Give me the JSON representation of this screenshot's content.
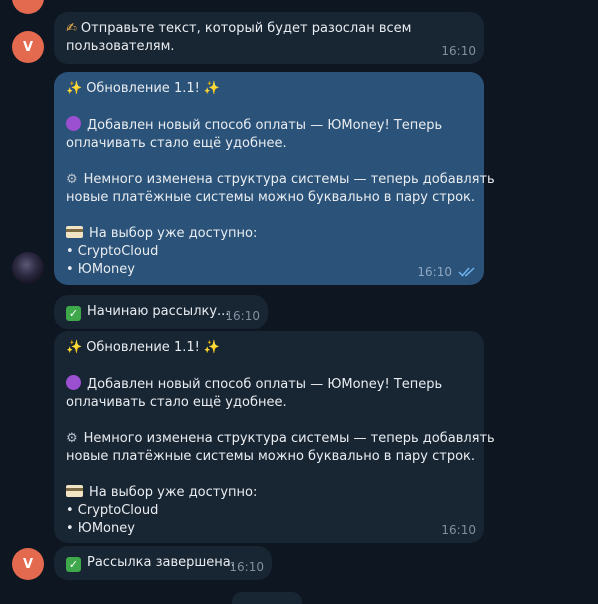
{
  "messages": {
    "prompt": {
      "avatar_letter": "V",
      "line1": "Отправьте текст, который будет разослан всем",
      "line2": "пользователям.",
      "time": "16:10",
      "icon": "writing-hand-emoji"
    },
    "broadcast_out": {
      "title": "Обновление 1.1!",
      "p1_line1": "Добавлен новый способ оплаты — ЮMoney! Теперь",
      "p1_line2": "оплачивать стало ещё удобнее.",
      "p2_line1": "Немного изменена структура системы — теперь добавлять",
      "p2_line2": "новые платёжные системы можно буквально в пару строк.",
      "p3_line1": "На выбор уже доступно:",
      "item1": "• CryptoCloud",
      "item2": "• ЮMoney",
      "time": "16:10",
      "status_icon": "double-check-icon"
    },
    "starting": {
      "text": "Начинаю рассылку...",
      "time": "16:10",
      "icon": "check-mark-emoji"
    },
    "broadcast_in": {
      "title": "Обновление 1.1!",
      "p1_line1": "Добавлен новый способ оплаты — ЮMoney! Теперь",
      "p1_line2": "оплачивать стало ещё удобнее.",
      "p2_line1": "Немного изменена структура системы — теперь добавлять",
      "p2_line2": "новые платёжные системы можно буквально в пару строк.",
      "p3_line1": "На выбор уже доступно:",
      "item1": "• CryptoCloud",
      "item2": "• ЮMoney",
      "time": "16:10"
    },
    "finished": {
      "avatar_letter": "V",
      "text": "Рассылка завершена.",
      "time": "16:10",
      "icon": "check-mark-emoji"
    }
  },
  "colors": {
    "background": "#0e1621",
    "incoming_bubble": "#182533",
    "outgoing_bubble": "#2b5278",
    "avatar": "#e36a4f"
  }
}
